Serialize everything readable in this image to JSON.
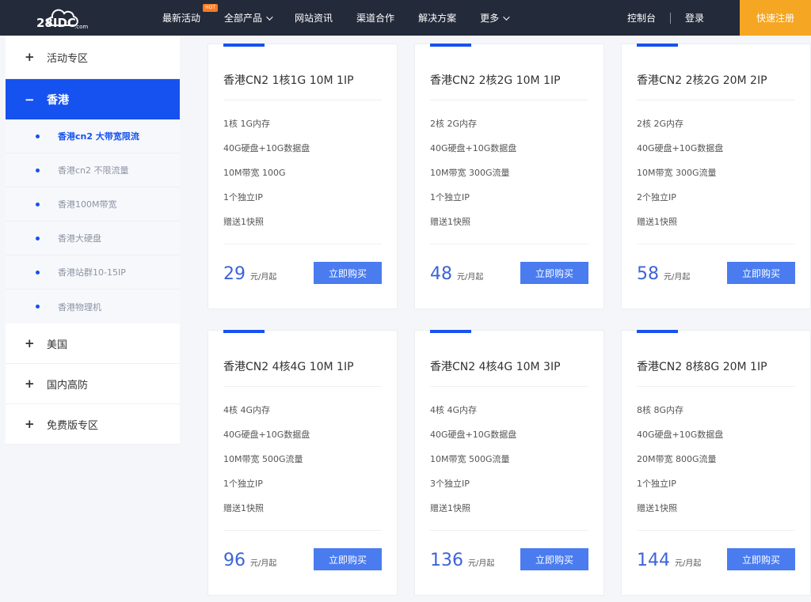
{
  "header": {
    "logo_text": "28IDC",
    "logo_sub": ".com",
    "nav": [
      {
        "label": "最新活动",
        "badge": "HOT",
        "dropdown": false
      },
      {
        "label": "全部产品",
        "dropdown": true
      },
      {
        "label": "网站资讯",
        "dropdown": false
      },
      {
        "label": "渠道合作",
        "dropdown": false
      },
      {
        "label": "解决方案",
        "dropdown": false
      },
      {
        "label": "更多",
        "dropdown": true
      }
    ],
    "console": "控制台",
    "login": "登录",
    "register": "快速注册"
  },
  "sidebar": {
    "top_group": {
      "icon": "+",
      "label": "活动专区"
    },
    "active_group": {
      "icon": "−",
      "label": "香港"
    },
    "sub_items": [
      {
        "label": "香港cn2 大带宽限流",
        "current": true
      },
      {
        "label": "香港cn2 不限流量",
        "current": false
      },
      {
        "label": "香港100M带宽",
        "current": false
      },
      {
        "label": "香港大硬盘",
        "current": false
      },
      {
        "label": "香港站群10-15IP",
        "current": false
      },
      {
        "label": "香港物理机",
        "current": false
      }
    ],
    "lower_groups": [
      {
        "icon": "+",
        "label": "美国"
      },
      {
        "icon": "+",
        "label": "国内高防"
      },
      {
        "icon": "+",
        "label": "免费版专区"
      }
    ]
  },
  "cards": [
    {
      "title": "香港CN2 1核1G 10M 1IP",
      "features": [
        "1核 1G内存",
        "40G硬盘+10G数据盘",
        "10M带宽 100G",
        "1个独立IP",
        "赠送1快照"
      ],
      "price": "29",
      "unit": "元/月起",
      "button": "立即购买"
    },
    {
      "title": "香港CN2 2核2G 10M 1IP",
      "features": [
        "2核 2G内存",
        "40G硬盘+10G数据盘",
        "10M带宽 300G流量",
        "1个独立IP",
        "赠送1快照"
      ],
      "price": "48",
      "unit": "元/月起",
      "button": "立即购买"
    },
    {
      "title": "香港CN2 2核2G 20M 2IP",
      "features": [
        "2核 2G内存",
        "40G硬盘+10G数据盘",
        "10M带宽 300G流量",
        "2个独立IP",
        "赠送1快照"
      ],
      "price": "58",
      "unit": "元/月起",
      "button": "立即购买"
    },
    {
      "title": "香港CN2 4核4G 10M 1IP",
      "features": [
        "4核 4G内存",
        "40G硬盘+10G数据盘",
        "10M带宽 500G流量",
        "1个独立IP",
        "赠送1快照"
      ],
      "price": "96",
      "unit": "元/月起",
      "button": "立即购买"
    },
    {
      "title": "香港CN2 4核4G 10M 3IP",
      "features": [
        "4核 4G内存",
        "40G硬盘+10G数据盘",
        "10M带宽 500G流量",
        "3个独立IP",
        "赠送1快照"
      ],
      "price": "136",
      "unit": "元/月起",
      "button": "立即购买"
    },
    {
      "title": "香港CN2 8核8G 20M 1IP",
      "features": [
        "8核 8G内存",
        "40G硬盘+10G数据盘",
        "20M带宽 800G流量",
        "1个独立IP",
        "赠送1快照"
      ],
      "price": "144",
      "unit": "元/月起",
      "button": "立即购买"
    }
  ],
  "colors": {
    "nav_bg": "#232a3a",
    "accent_blue": "#1652f0",
    "button_blue": "#4a7cf0",
    "price_blue": "#3d63d9",
    "register_orange": "#f5a623",
    "hot_badge": "#ff7a1f"
  }
}
